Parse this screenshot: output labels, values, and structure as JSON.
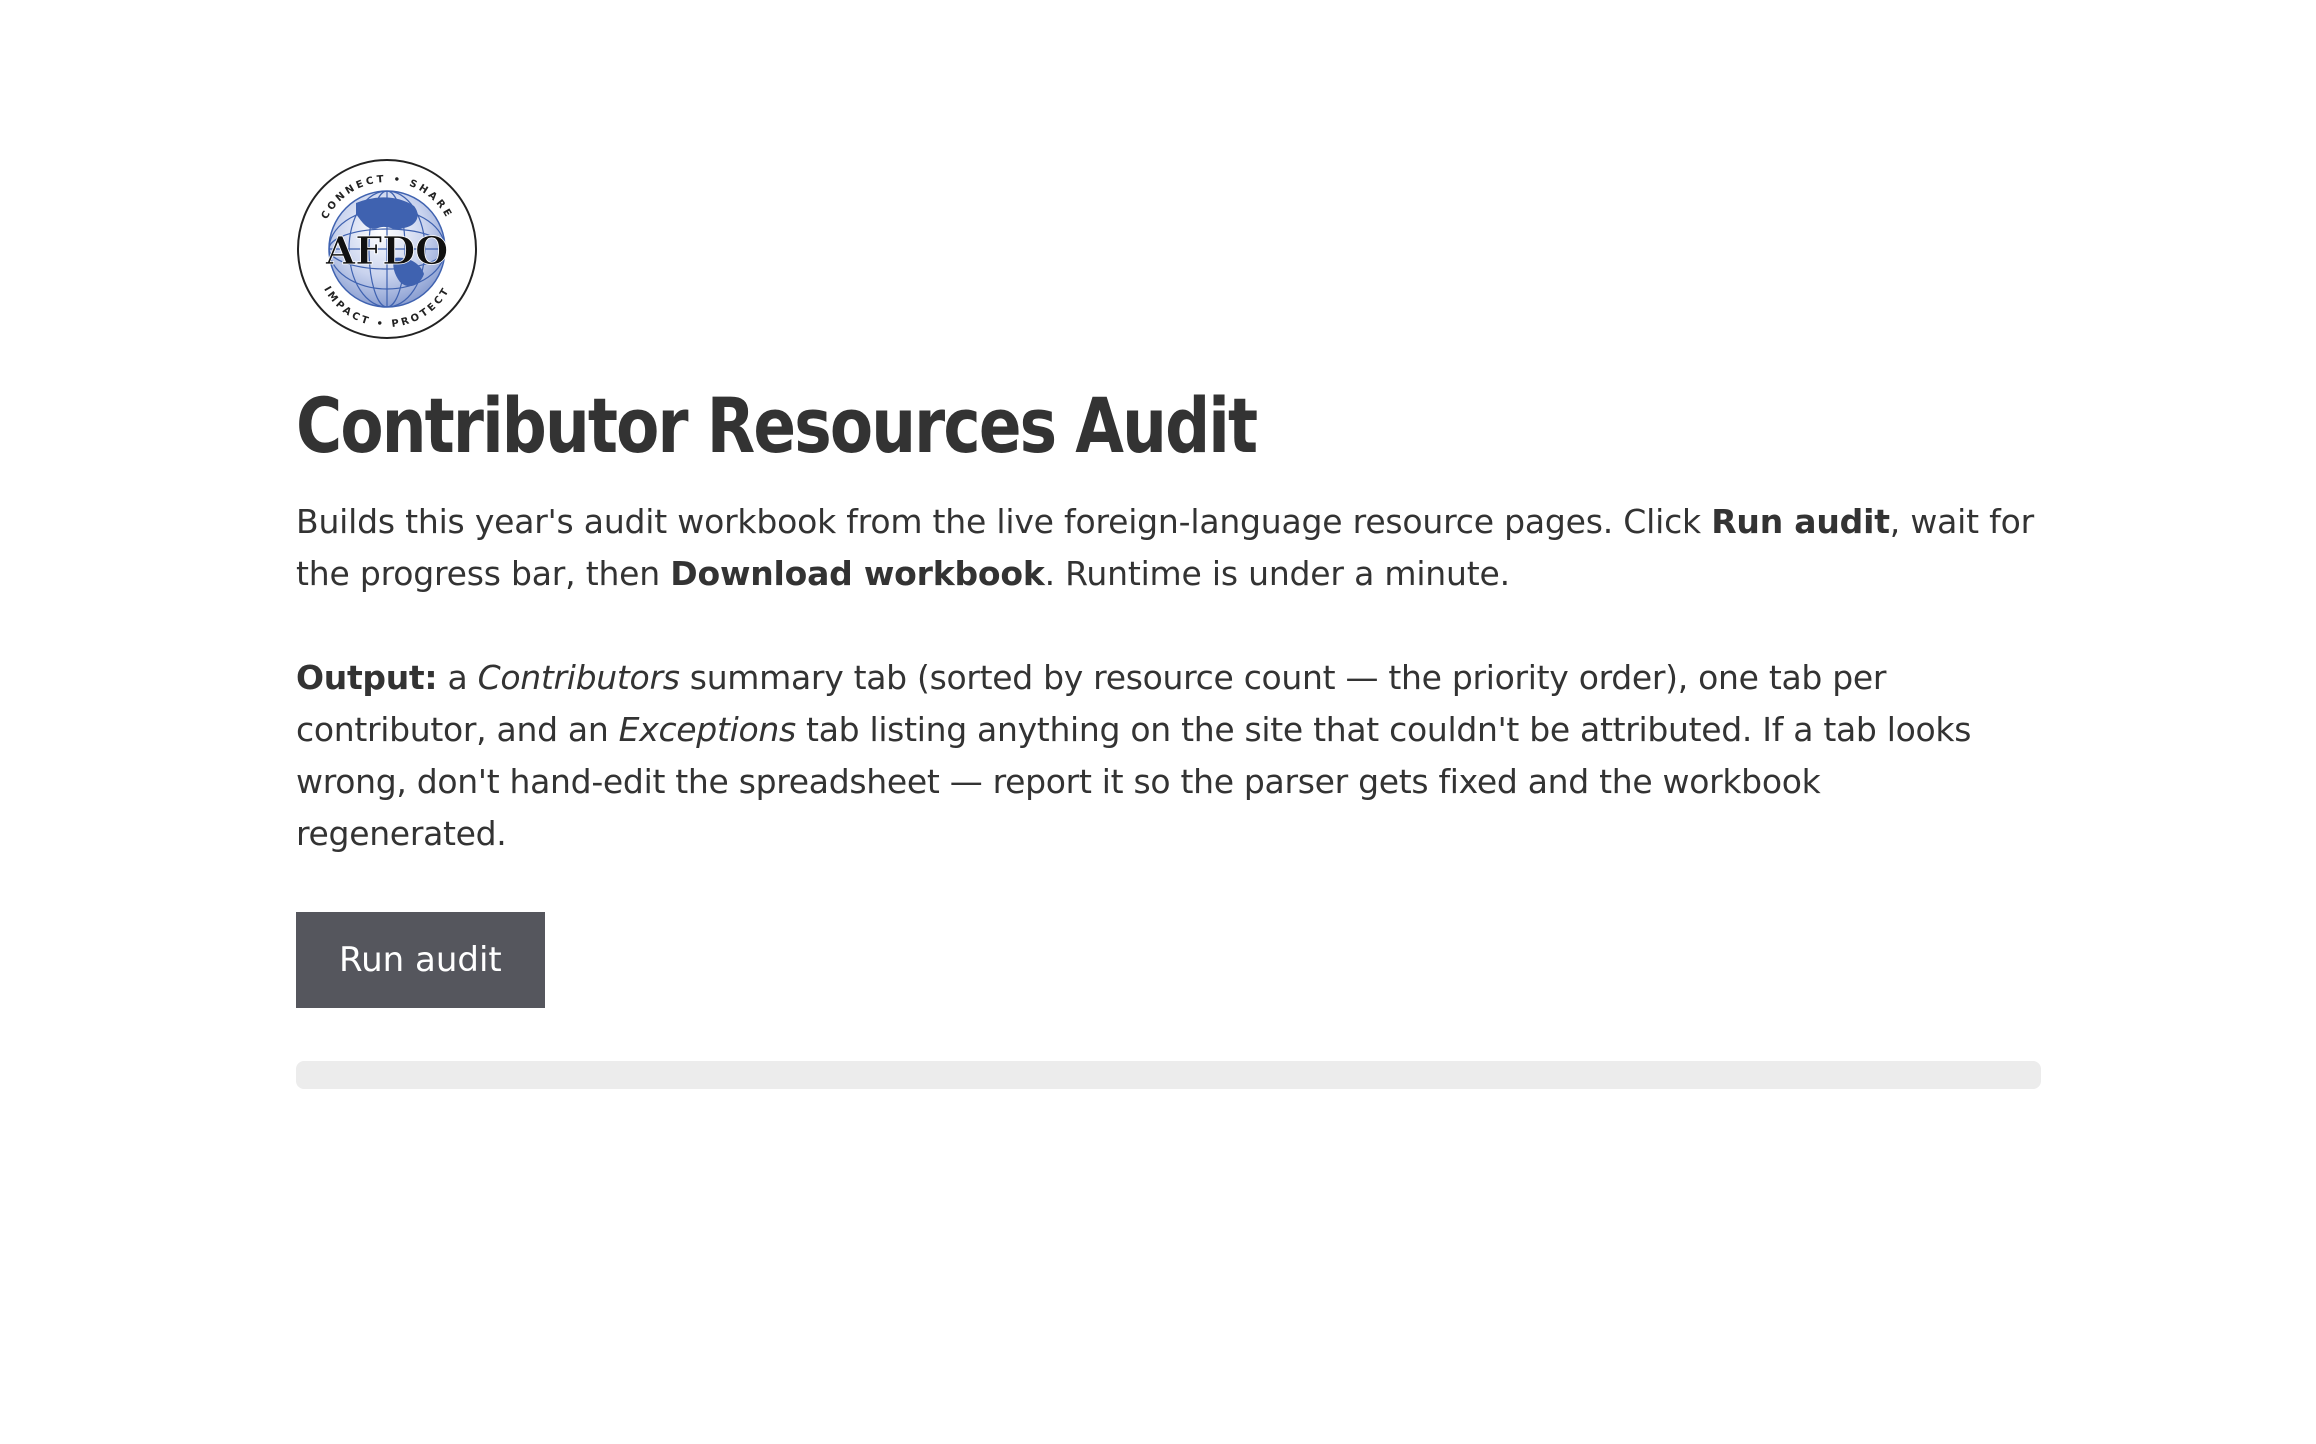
{
  "logo": {
    "text": "AFDO",
    "ring_top": "CONNECT • SHARE",
    "ring_bottom": "IMPACT • PROTECT"
  },
  "page": {
    "title": "Contributor Resources Audit"
  },
  "intro": {
    "part1": "Builds this year's audit workbook from the live foreign-language resource pages. Click ",
    "bold1": "Run audit",
    "part2": ", wait for the progress bar, then ",
    "bold2": "Download workbook",
    "part3": ". Runtime is under a minute."
  },
  "output": {
    "label": "Output:",
    "part1": " a ",
    "em1": "Contributors",
    "part2": " summary tab (sorted by resource count — the priority order), one tab per contributor, and an ",
    "em2": "Exceptions",
    "part3": " tab listing anything on the site that couldn't be attributed. If a tab looks wrong, don't hand-edit the spreadsheet — report it so the parser gets fixed and the workbook regenerated."
  },
  "actions": {
    "run_label": "Run audit"
  },
  "progress": {
    "value": 0
  },
  "colors": {
    "button_bg": "#55565d",
    "text": "#333333",
    "track": "#ececec",
    "globe_blue": "#3f62b0"
  }
}
